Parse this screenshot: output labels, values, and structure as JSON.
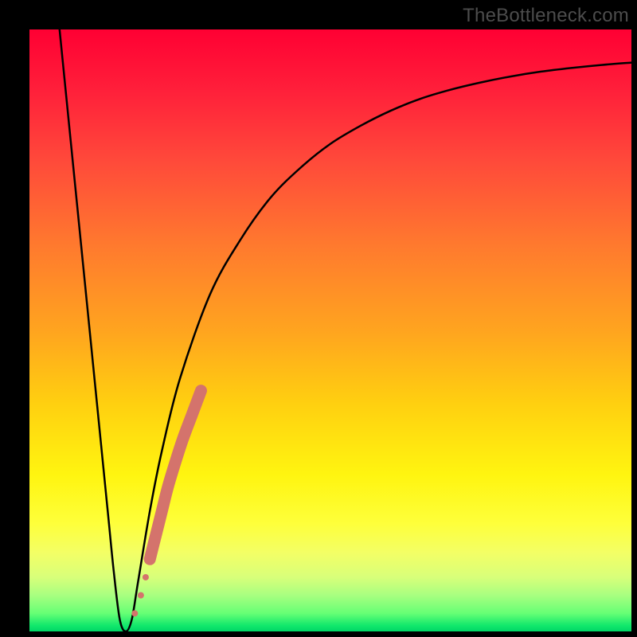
{
  "watermark": "TheBottleneck.com",
  "chart_data": {
    "type": "line",
    "title": "",
    "xlabel": "",
    "ylabel": "",
    "xlim": [
      0,
      100
    ],
    "ylim": [
      0,
      100
    ],
    "grid": false,
    "legend": false,
    "series": [
      {
        "name": "curve",
        "color": "#000000",
        "x": [
          5,
          7,
          9,
          11,
          13,
          14,
          15,
          16,
          17,
          18,
          20,
          22,
          25,
          30,
          35,
          40,
          45,
          50,
          55,
          60,
          65,
          70,
          75,
          80,
          85,
          90,
          95,
          100
        ],
        "y": [
          100,
          80,
          60,
          40,
          20,
          10,
          2,
          0,
          2,
          8,
          20,
          30,
          42,
          56,
          65,
          72,
          77,
          81,
          84,
          86.5,
          88.5,
          90,
          91.2,
          92.2,
          93,
          93.6,
          94.1,
          94.5
        ]
      }
    ],
    "highlight": {
      "name": "highlight-segment",
      "color": "#d4736c",
      "points": [
        {
          "x": 17.5,
          "y": 3,
          "r": 4
        },
        {
          "x": 18.5,
          "y": 6,
          "r": 4
        },
        {
          "x": 19.3,
          "y": 9,
          "r": 4
        },
        {
          "x": 20.0,
          "y": 12,
          "r": 8
        },
        {
          "x": 21.0,
          "y": 16,
          "r": 8
        },
        {
          "x": 22.0,
          "y": 20,
          "r": 8
        },
        {
          "x": 23.0,
          "y": 24,
          "r": 8
        },
        {
          "x": 24.2,
          "y": 28,
          "r": 8
        },
        {
          "x": 25.5,
          "y": 32,
          "r": 8
        },
        {
          "x": 27.0,
          "y": 36,
          "r": 8
        },
        {
          "x": 28.5,
          "y": 40,
          "r": 8
        }
      ]
    }
  }
}
